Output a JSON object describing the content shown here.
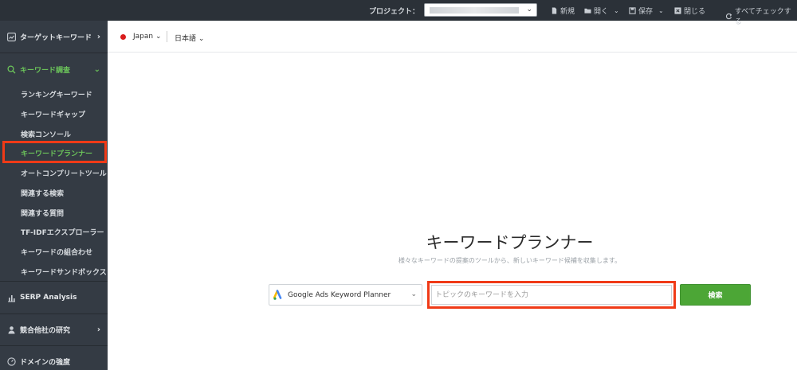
{
  "topbar": {
    "project_label": "プロジェクト：",
    "new_label": "新規",
    "open_label": "開く",
    "save_label": "保存",
    "close_label": "閉じる",
    "check_all_label": "すべてチェックする"
  },
  "sidebar": {
    "target_keywords": "ターゲットキーワード",
    "keyword_research": "キーワード調査",
    "sub_items": [
      "ランキングキーワード",
      "キーワードギャップ",
      "検索コンソール",
      "キーワードプランナー",
      "オートコンプリートツール",
      "関連する検索",
      "関連する質問",
      "TF-IDFエクスプローラー",
      "キーワードの組合わせ",
      "キーワードサンドボックス"
    ],
    "serp_analysis": "SERP Analysis",
    "competitor_research": "競合他社の研究",
    "domain_strength": "ドメインの強度"
  },
  "header": {
    "region": "Japan",
    "language": "日本語"
  },
  "main": {
    "title": "キーワードプランナー",
    "subtitle": "様々なキーワードの提案のツールから、新しいキーワード候補を収集します。",
    "tool_select": "Google Ads Keyword Planner",
    "keyword_placeholder": "トピックのキーワードを入力",
    "search_button": "検索"
  },
  "colors": {
    "accent_green": "#4ca636",
    "highlight_red": "#f03a17",
    "sidebar_bg": "#343b44",
    "topbar_bg": "#2b3138"
  }
}
